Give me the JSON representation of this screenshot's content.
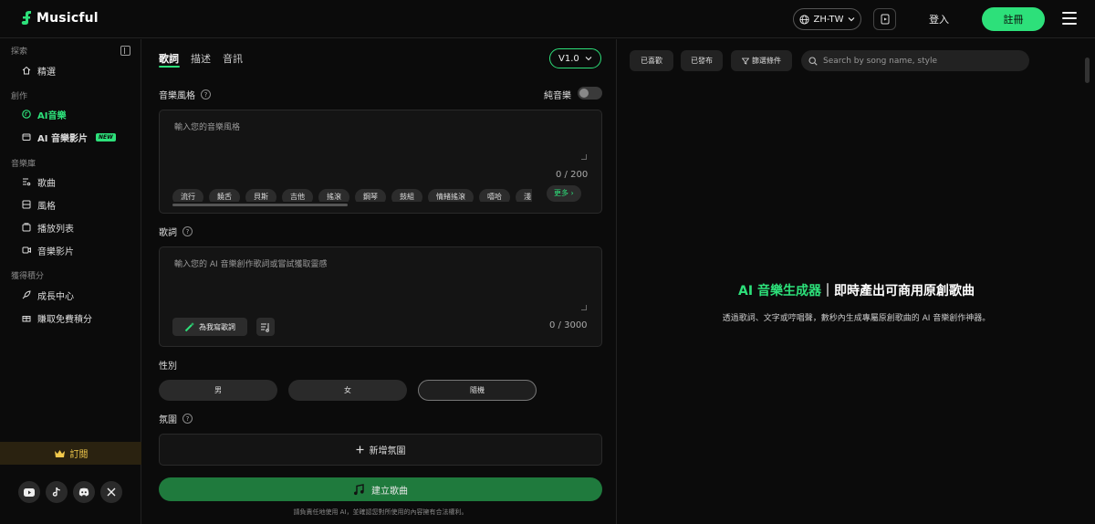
{
  "header": {
    "app_name": "Musicful",
    "language": "ZH-TW",
    "login": "登入",
    "register": "註冊"
  },
  "sidebar": {
    "sections": [
      {
        "label": "探索",
        "items": [
          {
            "label": "精選",
            "icon": "home-icon"
          }
        ]
      },
      {
        "label": "創作",
        "items": [
          {
            "label": "AI音樂",
            "icon": "music-disc-icon",
            "active": true
          },
          {
            "label": "AI 音樂影片",
            "icon": "video-icon",
            "badge": "NEW"
          }
        ]
      },
      {
        "label": "音樂庫",
        "items": [
          {
            "label": "歌曲",
            "icon": "song-list-icon"
          },
          {
            "label": "風格",
            "icon": "palette-icon"
          },
          {
            "label": "播放列表",
            "icon": "playlist-icon"
          },
          {
            "label": "音樂影片",
            "icon": "music-video-icon"
          }
        ]
      },
      {
        "label": "獲得積分",
        "items": [
          {
            "label": "成長中心",
            "icon": "rocket-icon"
          },
          {
            "label": "賺取免費積分",
            "icon": "gift-icon"
          }
        ]
      }
    ],
    "subscribe": "訂閱"
  },
  "composer": {
    "tabs": [
      "歌詞",
      "描述",
      "音訊"
    ],
    "version": "V1.0",
    "style_label": "音樂風格",
    "instrumental_label": "純音樂",
    "style_placeholder": "輸入您的音樂風格",
    "style_counter": "0 / 200",
    "style_chips": [
      "流行",
      "饒舌",
      "貝斯",
      "吉他",
      "搖滾",
      "鋼琴",
      "鼓組",
      "情緒搖滾",
      "嘻哈",
      "淺"
    ],
    "more_chip": "更多 ›",
    "lyrics_label": "歌詞",
    "lyrics_placeholder": "輸入您的 AI 音樂創作歌詞或嘗試獲取靈感",
    "write_lyrics_button": "為我寫歌詞",
    "lyrics_counter": "0 / 3000",
    "gender_label": "性別",
    "genders": [
      "男",
      "女",
      "隨機"
    ],
    "mood_label": "氛圍",
    "add_mood": "新增氛圍",
    "create_button": "建立歌曲",
    "disclaimer": "請負責任地使用 AI，並確認您對所使用的內容擁有合法權利。"
  },
  "library": {
    "filters": [
      "已喜歡",
      "已發布",
      "篩選條件"
    ],
    "search_placeholder": "Search by song name, style",
    "hero_title_highlight": "AI 音樂生成器",
    "hero_title_rest": "｜即時產出可商用原創歌曲",
    "hero_subtitle": "透過歌詞、文字或哼唱聲，數秒內生成專屬原創歌曲的 AI 音樂創作神器。"
  },
  "colors": {
    "accent": "#2de07a",
    "create_button": "#1f7a3d",
    "subscribe_text": "#f2c94c"
  }
}
